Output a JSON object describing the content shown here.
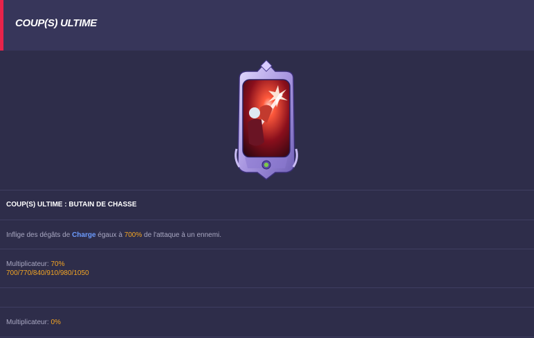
{
  "header": {
    "title": "COUP(S) ULTIME"
  },
  "card": {
    "icon": "ultimate-skill-card",
    "frame_color": "#b9a6e8",
    "gem_color": "#7cc84a"
  },
  "skill": {
    "title": "COUP(S) ULTIME : BUTAIN DE CHASSE",
    "description": {
      "prefix": "Inflige des dégâts de ",
      "damage_type": "Charge",
      "middle": " égaux à ",
      "percent": "700%",
      "suffix": " de l'attaque à un ennemi."
    },
    "multiplier_1": {
      "label": "Multiplicateur: ",
      "value": "70%",
      "levels": "700/770/840/910/980/1050"
    },
    "multiplier_2": {
      "label": "Multiplicateur: ",
      "value": "0%"
    }
  },
  "colors": {
    "accent": "#e8234a",
    "highlight_blue": "#6c9bff",
    "highlight_orange": "#f5a623",
    "background": "#2e2d4a",
    "header_bg": "#37365a"
  }
}
